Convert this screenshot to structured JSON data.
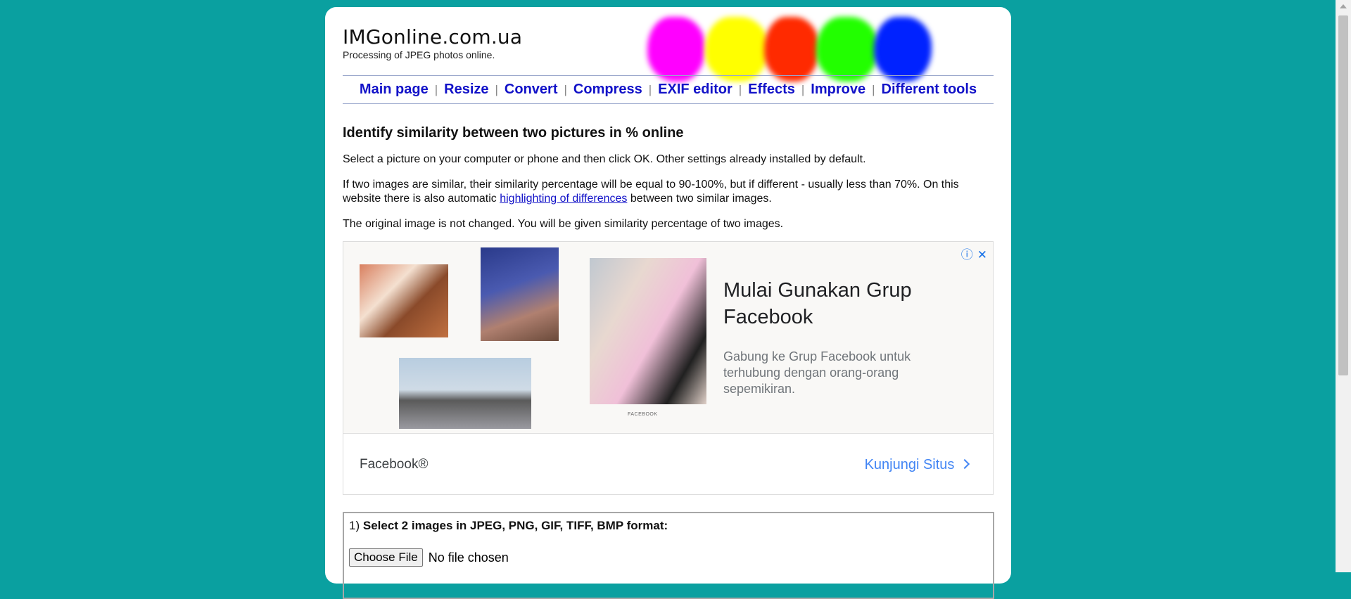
{
  "site": {
    "logo": "IMGonline.com.ua",
    "tagline": "Processing of JPEG photos online."
  },
  "color_blobs": [
    "#ff00ff",
    "#ffff00",
    "#ff2a00",
    "#22ff00",
    "#0022ff"
  ],
  "nav": [
    {
      "label": "Main page"
    },
    {
      "label": "Resize"
    },
    {
      "label": "Convert"
    },
    {
      "label": "Compress"
    },
    {
      "label": "EXIF editor"
    },
    {
      "label": "Effects"
    },
    {
      "label": "Improve"
    },
    {
      "label": "Different tools"
    }
  ],
  "nav_separator": "|",
  "content": {
    "title": "Identify similarity between two pictures in % online",
    "p1": "Select a picture on your computer or phone and then click OK. Other settings already installed by default.",
    "p2_before": "If two images are similar, their similarity percentage will be equal to 90-100%, but if different - usually less than 70%. On this website there is also automatic ",
    "p2_link": "highlighting of differences",
    "p2_after": " between two similar images.",
    "p3": "The original image is not changed. You will be given similarity percentage of two images."
  },
  "ad": {
    "headline": "Mulai Gunakan Grup Facebook",
    "description": "Gabung ke Grup Facebook untuk terhubung dengan orang-orang sepemikiran.",
    "advertiser": "Facebook®",
    "cta": "Kunjungi Situs",
    "image_caption": "FACEBOOK",
    "info_icon": "ⓘ",
    "close_icon": "✕"
  },
  "form": {
    "step_number": "1)",
    "step_label": "Select 2 images in JPEG, PNG, GIF, TIFF, BMP format:",
    "file_button": "Choose File",
    "file_status": "No file chosen"
  }
}
